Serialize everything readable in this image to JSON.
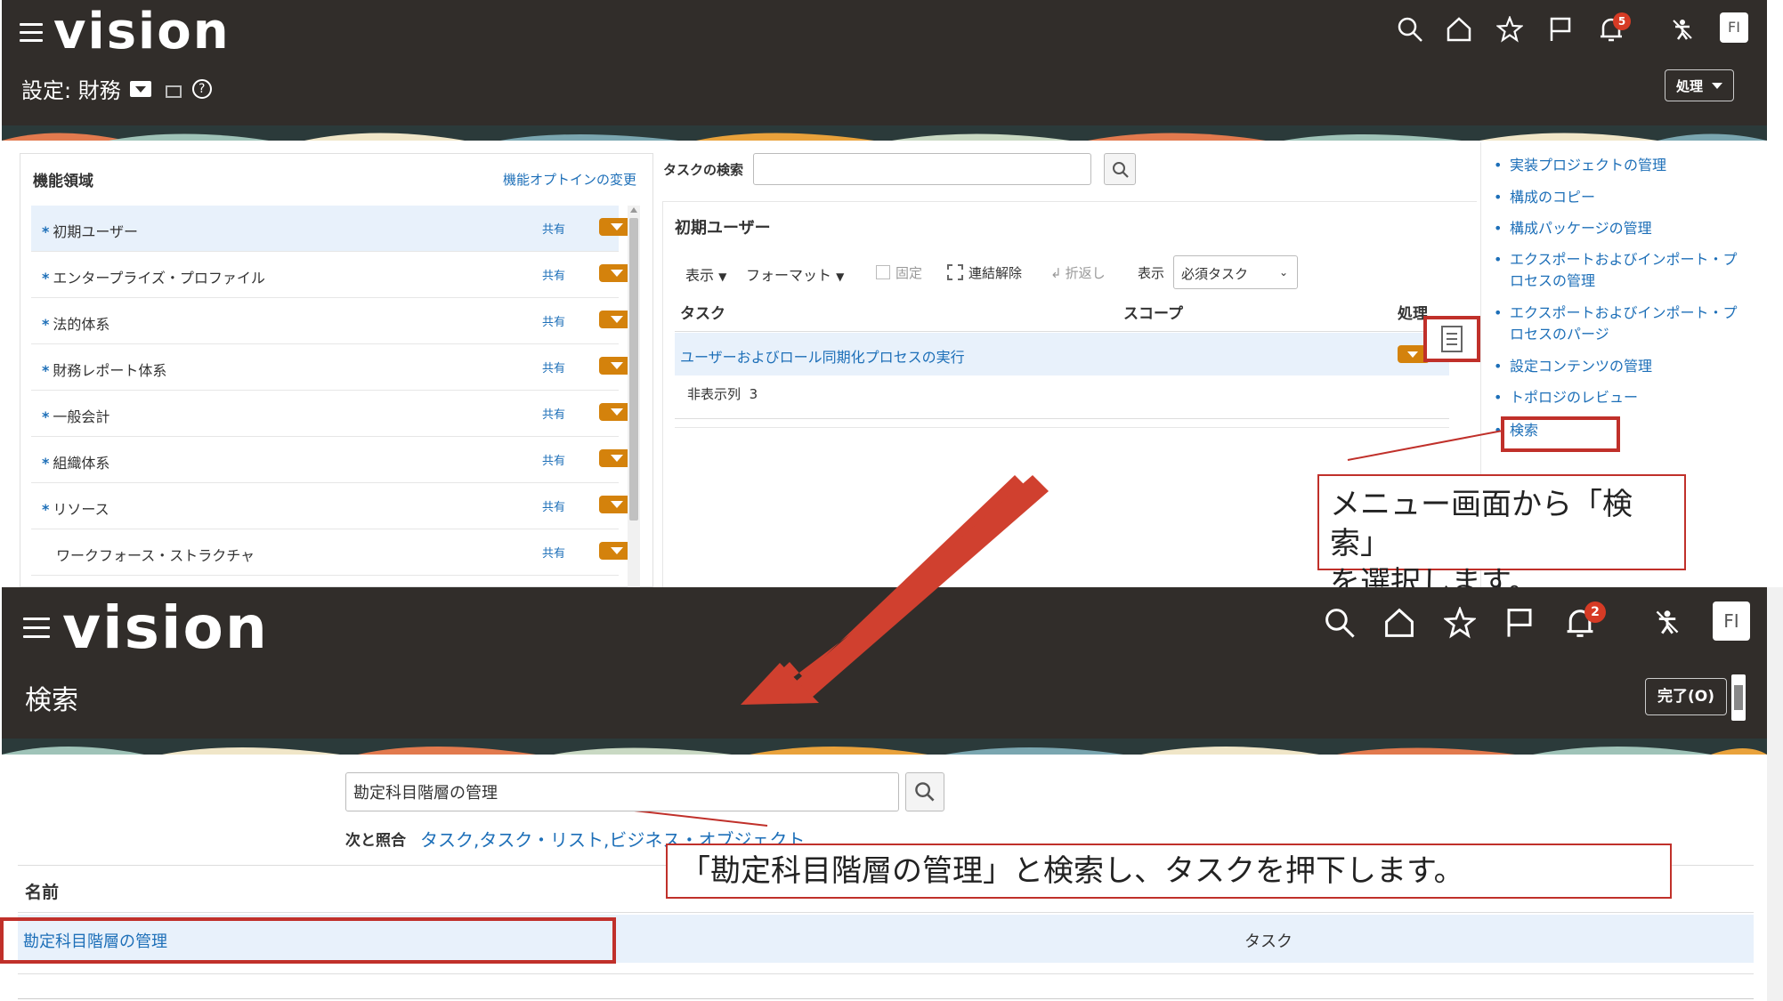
{
  "top": {
    "logo": "vision",
    "page_title": "設定: 財務",
    "notif_count": "5",
    "avatar": "FI",
    "action_button": "処理",
    "left_panel": {
      "title": "機能領域",
      "change_link": "機能オプトインの変更",
      "items": [
        {
          "label": "初期ユーザー",
          "required": "*",
          "share": "共有"
        },
        {
          "label": "エンタープライズ・プロファイル",
          "required": "*",
          "share": "共有"
        },
        {
          "label": "法的体系",
          "required": "*",
          "share": "共有"
        },
        {
          "label": "財務レポート体系",
          "required": "*",
          "share": "共有"
        },
        {
          "label": "一般会計",
          "required": "*",
          "share": "共有"
        },
        {
          "label": "組織体系",
          "required": "*",
          "share": "共有"
        },
        {
          "label": "リソース",
          "required": "*",
          "share": "共有"
        },
        {
          "label": "ワークフォース・ストラクチャ",
          "required": "",
          "share": "共有"
        }
      ]
    },
    "task_search": {
      "label": "タスクの検索",
      "value": ""
    },
    "task_section": {
      "title": "初期ユーザー",
      "toolbar": {
        "view": "表示",
        "format": "フォーマット",
        "freeze": "固定",
        "detach": "連結解除",
        "wrap": "折返し",
        "show_label": "表示",
        "show_value": "必須タスク"
      },
      "columns": {
        "task": "タスク",
        "scope": "スコープ",
        "action": "処理"
      },
      "row": {
        "task": "ユーザーおよびロール同期化プロセスの実行"
      },
      "hidden_label": "非表示列",
      "hidden_count": "3"
    },
    "right_links": [
      "実装プロジェクトの管理",
      "構成のコピー",
      "構成パッケージの管理",
      "エクスポートおよびインポート・プロセスの管理",
      "エクスポートおよびインポート・プロセスのパージ",
      "設定コンテンツの管理",
      "トポロジのレビュー",
      "検索"
    ],
    "callout_line1": "メニュー画面から「検索」",
    "callout_line2": "を選択します。"
  },
  "bottom": {
    "logo": "vision",
    "page_title": "検索",
    "notif_count": "2",
    "avatar": "FI",
    "done_button": "完了(O)",
    "search_value": "勘定科目階層の管理",
    "match_label": "次と照合",
    "match_links": "タスク,タスク・リスト,ビジネス・オブジェクト",
    "name_header": "名前",
    "result_name": "勘定科目階層の管理",
    "result_type": "タスク",
    "callout": "「勘定科目階層の管理」と検索し、タスクを押下します。"
  },
  "colors": {
    "header_bg": "#312d2a",
    "link": "#1d6fb8",
    "accent_orange": "#d4820c",
    "annotation_red": "#c0302a",
    "selected_row": "#e8f1fb"
  }
}
